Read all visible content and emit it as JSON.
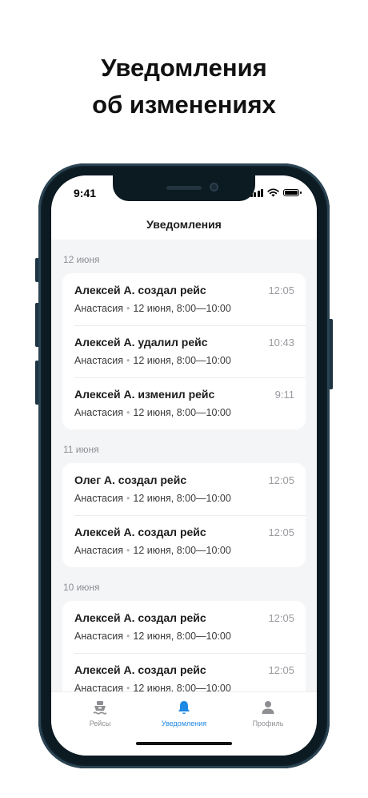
{
  "promo": {
    "line1": "Уведомления",
    "line2": "об изменениях"
  },
  "status_bar": {
    "time": "9:41",
    "icons": [
      "signal-icon",
      "wifi-icon",
      "battery-icon"
    ]
  },
  "header": {
    "title": "Уведомления"
  },
  "groups": [
    {
      "date": "12 июня",
      "items": [
        {
          "title": "Алексей А. создал рейс",
          "time": "12:05",
          "person": "Анастасия",
          "detail": "12 июня, 8:00—10:00"
        },
        {
          "title": "Алексей А. удалил рейс",
          "time": "10:43",
          "person": "Анастасия",
          "detail": "12 июня, 8:00—10:00"
        },
        {
          "title": "Алексей А. изменил рейс",
          "time": "9:11",
          "person": "Анастасия",
          "detail": "12 июня, 8:00—10:00"
        }
      ]
    },
    {
      "date": "11 июня",
      "items": [
        {
          "title": "Олег А. создал рейс",
          "time": "12:05",
          "person": "Анастасия",
          "detail": "12 июня, 8:00—10:00"
        },
        {
          "title": "Алексей А. создал рейс",
          "time": "12:05",
          "person": "Анастасия",
          "detail": "12 июня, 8:00—10:00"
        }
      ]
    },
    {
      "date": "10 июня",
      "items": [
        {
          "title": "Алексей А. создал рейс",
          "time": "12:05",
          "person": "Анастасия",
          "detail": "12 июня, 8:00—10:00"
        },
        {
          "title": "Алексей А. создал рейс",
          "time": "12:05",
          "person": "Анастасия",
          "detail": "12 июня, 8:00—10:00"
        }
      ]
    }
  ],
  "tabs": [
    {
      "label": "Рейсы",
      "icon": "ship-icon",
      "active": false
    },
    {
      "label": "Уведомления",
      "icon": "bell-icon",
      "active": true
    },
    {
      "label": "Профиль",
      "icon": "person-icon",
      "active": false
    }
  ],
  "colors": {
    "accent": "#1e88e5",
    "inactive": "#8e8e93",
    "background": "#f4f5f7"
  }
}
